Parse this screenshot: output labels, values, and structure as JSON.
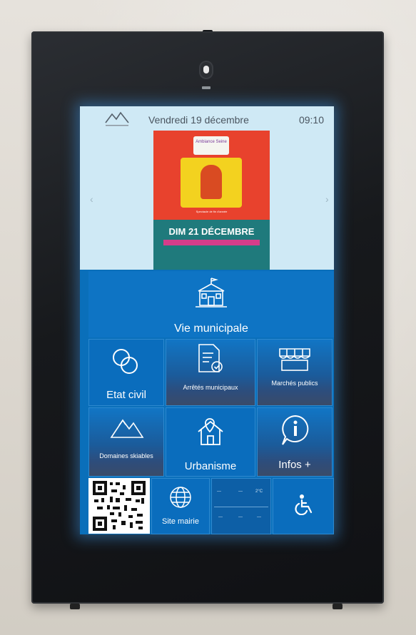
{
  "header": {
    "date": "Vendredi 19 décembre",
    "time": "09:10"
  },
  "carousel": {
    "prev_arrow": "‹",
    "next_arrow": "›",
    "poster": {
      "badge": "Ambiance Seine",
      "subtitle": "Spectacle de fin d'année",
      "date_headline": "DIM 21 DÉCEMBRE",
      "strip": "",
      "lines": ""
    }
  },
  "tiles": {
    "vie_municipale": "Vie municipale",
    "etat_civil": "Etat civil",
    "arretes": "Arrêtés municipaux",
    "marches": "Marchés publics",
    "domaines": "Domaines skiables",
    "urbanisme": "Urbanisme",
    "infos": "Infos +",
    "site_mairie": "Site mairie"
  },
  "weather_widget": {
    "top": [
      "—",
      "—",
      "2°C"
    ],
    "bottom": [
      "—",
      "—",
      "—"
    ]
  },
  "colors": {
    "tile_blue": "#0a6dbd",
    "header_bg": "#cfe9f5",
    "kiosk_frame": "#17191c"
  }
}
